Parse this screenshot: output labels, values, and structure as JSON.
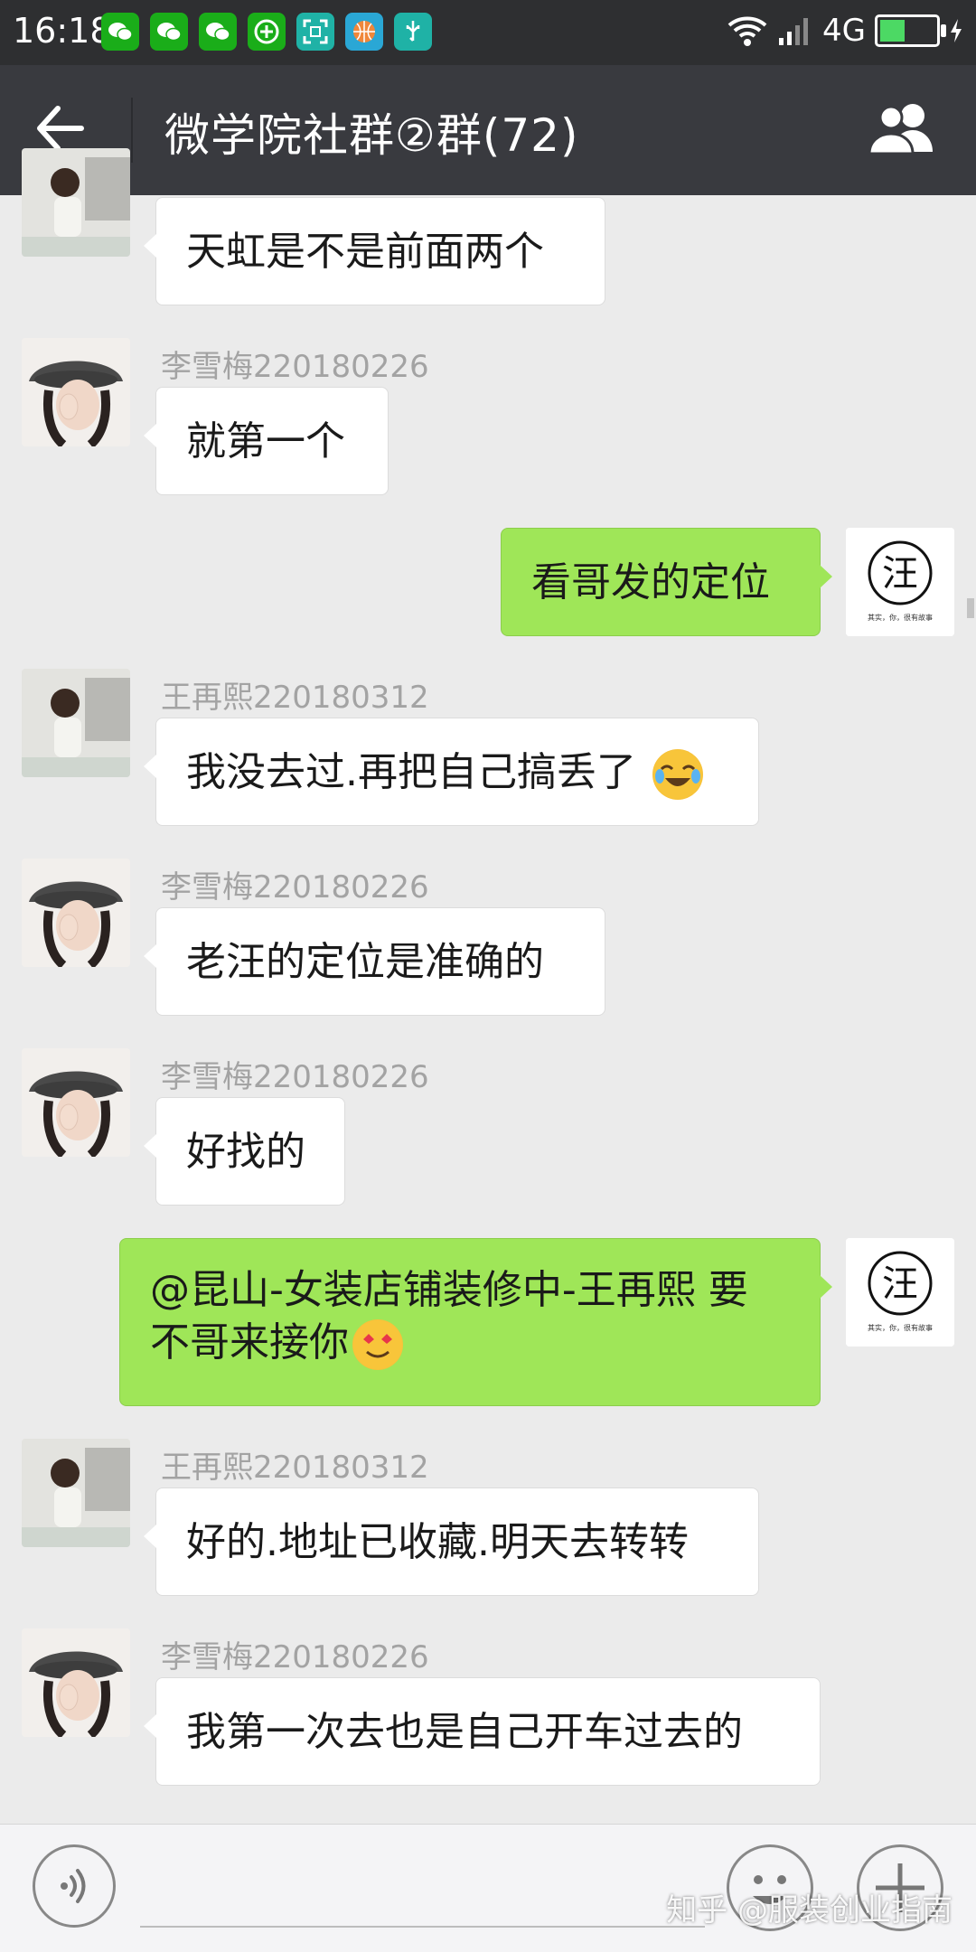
{
  "status_bar": {
    "time": "16:18",
    "network": "4G",
    "battery_level": 0.45,
    "notification_icons": [
      "wechat-icon",
      "wechat-icon",
      "wechat-icon",
      "plus-app-icon",
      "scan-icon",
      "basketball-icon",
      "usb-icon"
    ]
  },
  "header": {
    "title": "微学院社群②群(72)",
    "back_icon": "arrow-left-icon",
    "members_icon": "group-members-icon"
  },
  "messages": [
    {
      "direction": "in",
      "sender": "",
      "avatar": "woman-sitting",
      "text": "天虹是不是前面两个"
    },
    {
      "direction": "in",
      "sender": "李雪梅220180226",
      "avatar": "woman-hat",
      "text": "就第一个"
    },
    {
      "direction": "out",
      "sender": "",
      "avatar": "wang-logo",
      "text": "看哥发的定位"
    },
    {
      "direction": "in",
      "sender": "王再熙220180312",
      "avatar": "woman-sitting",
      "text": "我没去过.再把自己搞丢了",
      "emoji": "crying-laughing"
    },
    {
      "direction": "in",
      "sender": "李雪梅220180226",
      "avatar": "woman-hat",
      "text": "老汪的定位是准确的"
    },
    {
      "direction": "in",
      "sender": "李雪梅220180226",
      "avatar": "woman-hat",
      "text": "好找的"
    },
    {
      "direction": "out",
      "sender": "",
      "avatar": "wang-logo",
      "text_line1": "@昆山-女装店铺装修中-王再熙  要",
      "text_line2": "不哥来接你",
      "emoji": "heart-eyes"
    },
    {
      "direction": "in",
      "sender": "王再熙220180312",
      "avatar": "woman-sitting",
      "text": "好的.地址已收藏.明天去转转"
    },
    {
      "direction": "in",
      "sender": "李雪梅220180226",
      "avatar": "woman-hat",
      "text": "我第一次去也是自己开车过去的"
    }
  ],
  "logo": {
    "char": "汪",
    "tagline": "其实，你，很有故事"
  },
  "input_bar": {
    "voice_icon": "voice-icon",
    "emoji_icon": "emoji-face-icon",
    "plus_icon": "plus-icon"
  },
  "watermark": "知乎 @服装创业指南",
  "colors": {
    "header_bg": "#393a3f",
    "status_bg": "#2e2f31",
    "chat_bg": "#ebebeb",
    "bubble_out": "#9fe658",
    "bubble_in": "#ffffff"
  }
}
